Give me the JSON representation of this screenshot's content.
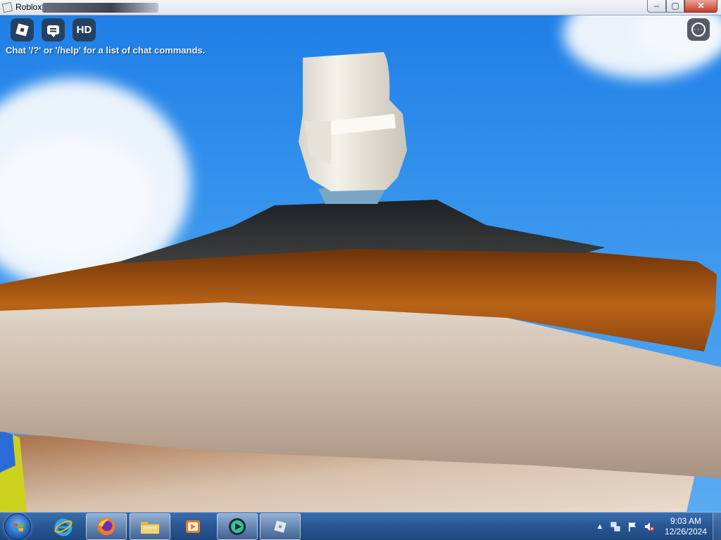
{
  "window": {
    "title": "Roblox",
    "controls": {
      "minimize": "‒",
      "maximize": "▢",
      "close": "✕"
    }
  },
  "hud": {
    "buttons": [
      {
        "name": "roblox-menu",
        "icon": "roblox-logo-icon"
      },
      {
        "name": "chat",
        "icon": "chat-icon"
      },
      {
        "name": "hd",
        "label": "HD"
      }
    ],
    "menu_icon": "more-options-icon",
    "chat_hint": "Chat '/?' or '/help' for a list of chat commands."
  },
  "taskbar": {
    "start_icon": "windows-start-icon",
    "items": [
      {
        "name": "internet-explorer",
        "icon": "internet-explorer-icon",
        "active": false
      },
      {
        "name": "firefox",
        "icon": "firefox-icon",
        "active": true
      },
      {
        "name": "file-explorer",
        "icon": "folder-icon",
        "active": true
      },
      {
        "name": "media-player",
        "icon": "media-player-icon",
        "active": false
      },
      {
        "name": "app-green",
        "icon": "green-app-icon",
        "active": true
      },
      {
        "name": "roblox",
        "icon": "roblox-icon",
        "active": true
      }
    ],
    "tray": {
      "icons": [
        "show-hidden-icons",
        "network-icon",
        "action-center-flag-icon",
        "volume-muted-icon"
      ],
      "time": "9:03 AM",
      "date": "12/26/2024"
    }
  },
  "colors": {
    "sky": "#2f8ceb",
    "taskbar": "#2a5895",
    "hud_button": "#28303a"
  }
}
